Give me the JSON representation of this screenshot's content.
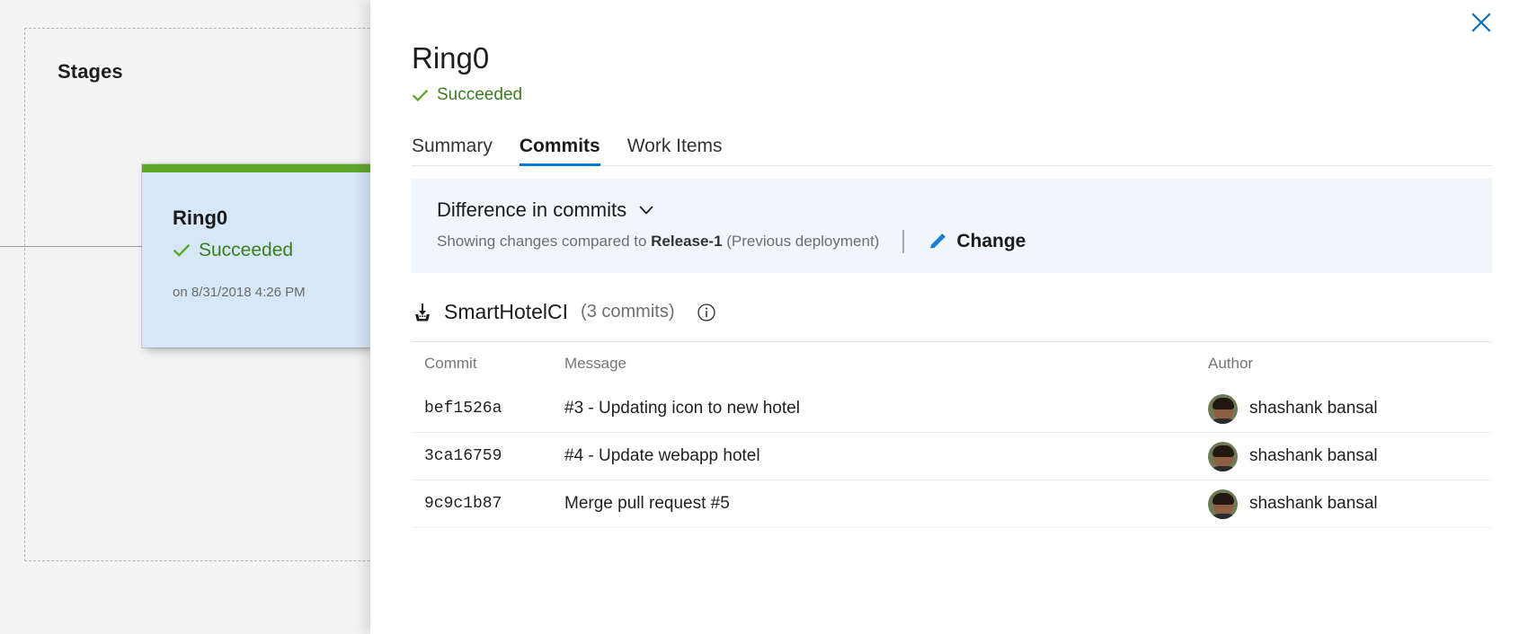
{
  "left_canvas": {
    "stages_label": "Stages",
    "stage_card": {
      "title": "Ring0",
      "status": "Succeeded",
      "timestamp": "on 8/31/2018 4:26 PM",
      "status_color": "#3c7d22",
      "accent_color": "#5fa72b",
      "card_bg": "#d6e8f7"
    }
  },
  "panel": {
    "title": "Ring0",
    "status": "Succeeded",
    "status_color": "#3c7d22",
    "close_label": "Close",
    "close_color": "#0c6cb6",
    "tabs": [
      {
        "label": "Summary",
        "active": false
      },
      {
        "label": "Commits",
        "active": true
      },
      {
        "label": "Work Items",
        "active": false
      }
    ],
    "tab_accent_color": "#0078d4",
    "difference": {
      "title": "Difference in commits",
      "description_prefix": "Showing changes compared to ",
      "description_bold": "Release-1",
      "description_suffix": " (Previous deployment)",
      "change_label": "Change",
      "banner_bg": "#eff6fc"
    },
    "repo": {
      "name": "SmartHotelCI",
      "commit_count": "(3 commits)",
      "icon": "artifact-download-icon",
      "info_icon": "info-icon"
    },
    "table": {
      "columns": [
        "Commit",
        "Message",
        "Author"
      ],
      "rows": [
        {
          "commit": "bef1526a",
          "message": "#3 - Updating icon to new hotel",
          "author": "shashank bansal"
        },
        {
          "commit": "3ca16759",
          "message": "#4 - Update webapp hotel",
          "author": "shashank bansal"
        },
        {
          "commit": "9c9c1b87",
          "message": "Merge pull request #5",
          "author": "shashank bansal"
        }
      ]
    }
  }
}
